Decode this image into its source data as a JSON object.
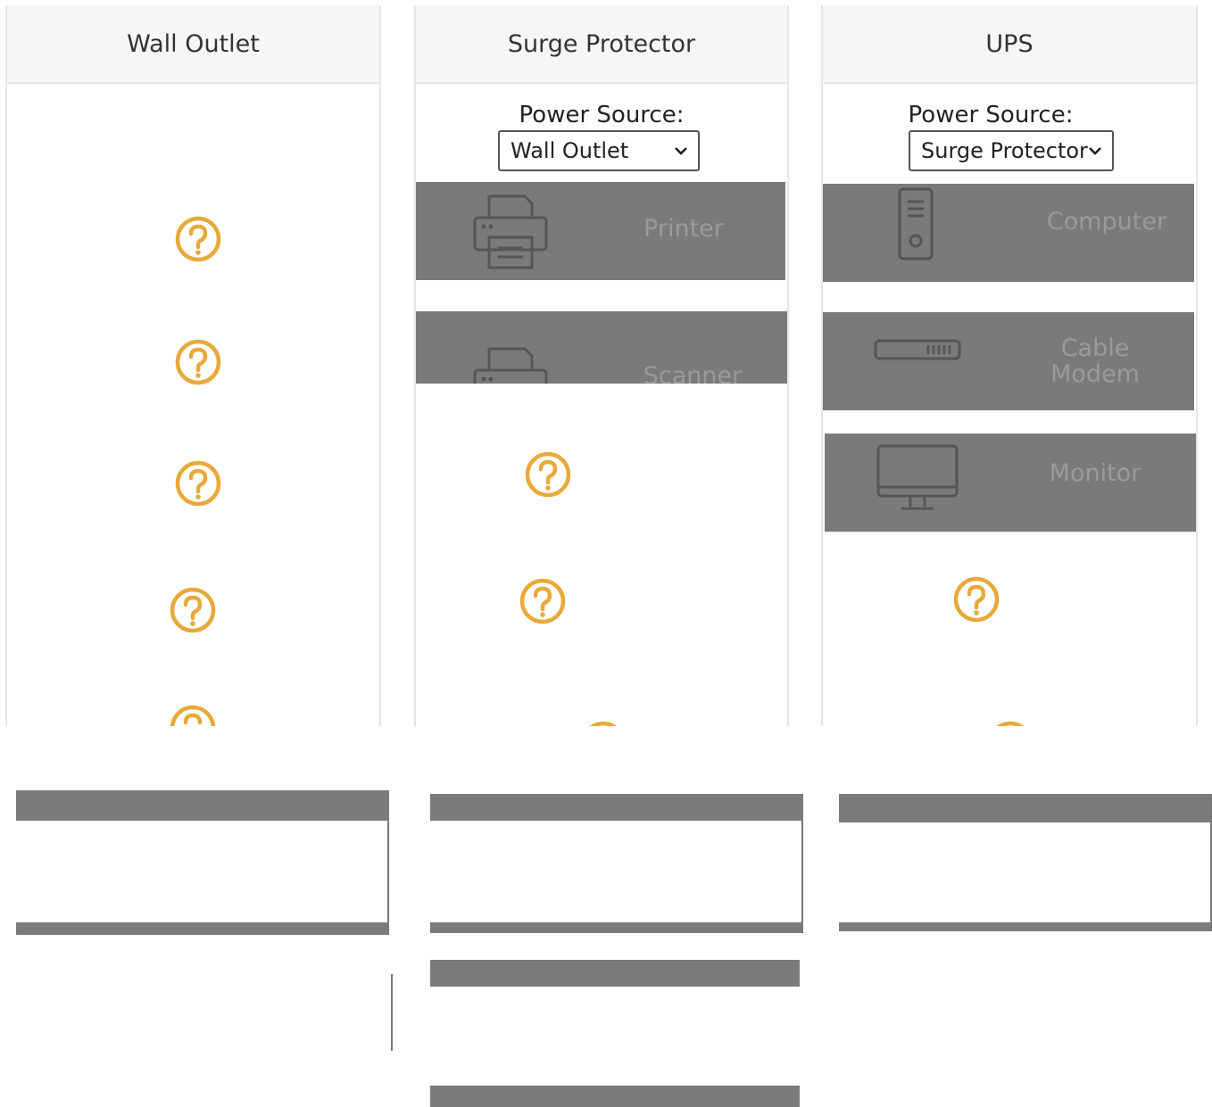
{
  "columns": {
    "wall": {
      "title": "Wall Outlet"
    },
    "surge": {
      "title": "Surge Protector",
      "power_source_label": "Power Source:",
      "power_source_value": "Wall Outlet",
      "devices": [
        {
          "label": "Printer",
          "icon": "printer-icon"
        },
        {
          "label": "Scanner",
          "icon": "scanner-icon"
        }
      ]
    },
    "ups": {
      "title": "UPS",
      "power_source_label": "Power Source:",
      "power_source_value": "Surge Protector",
      "devices": [
        {
          "label": "Computer",
          "icon": "computer-tower-icon"
        },
        {
          "label": "Cable\nModem",
          "icon": "cable-modem-icon"
        },
        {
          "label": "Monitor",
          "icon": "monitor-icon"
        }
      ]
    }
  },
  "colors": {
    "device_tile": "#7a7a7b",
    "device_label": "#9a9a9c",
    "question_icon": "#e8a93a",
    "header_bg": "#f6f6f6"
  }
}
